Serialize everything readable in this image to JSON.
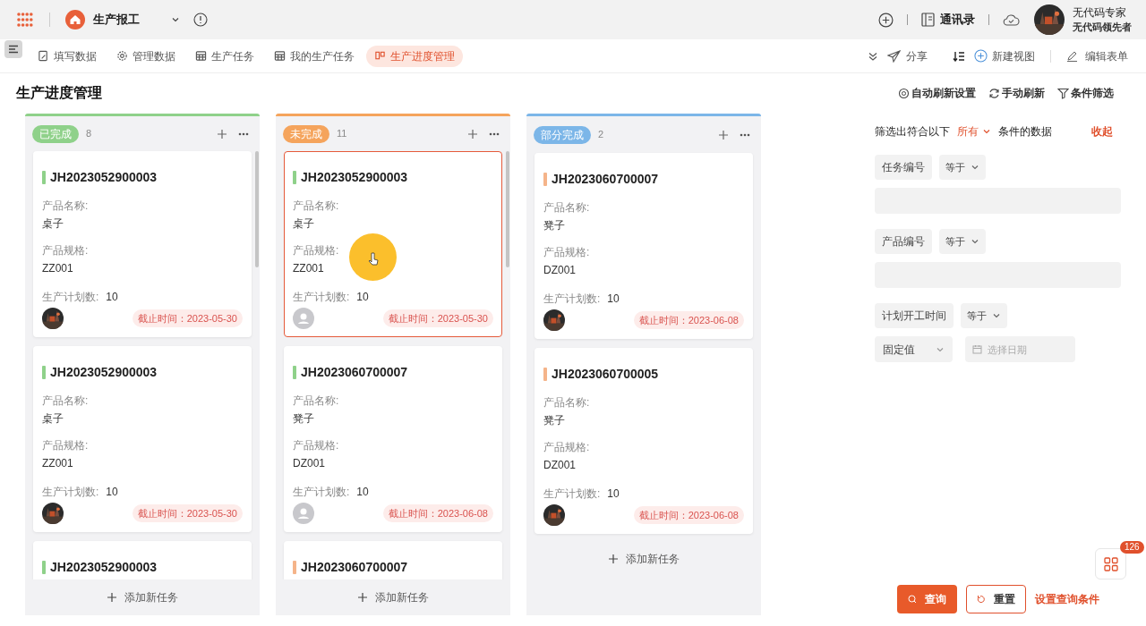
{
  "app": {
    "title": "生产报工"
  },
  "header": {
    "contacts": "通讯录",
    "user_name": "无代码专家",
    "user_role": "无代码领先者"
  },
  "tabs": [
    {
      "label": "填写数据",
      "selected": false
    },
    {
      "label": "管理数据",
      "selected": false
    },
    {
      "label": "生产任务",
      "selected": false
    },
    {
      "label": "我的生产任务",
      "selected": false
    },
    {
      "label": "生产进度管理",
      "selected": true
    }
  ],
  "toolbar": {
    "share": "分享",
    "new_view": "新建视图",
    "edit_form": "编辑表单"
  },
  "page_title": "生产进度管理",
  "page_actions": [
    "自动刷新设置",
    "手动刷新",
    "条件筛选"
  ],
  "columns": [
    {
      "label": "已完成",
      "count": "8",
      "color": "#8fd18a",
      "add_label": "添加新任务",
      "cards": [
        {
          "id": "JH2023052900003",
          "color": "#8fd18a",
          "selected": false,
          "name_label": "产品名称:",
          "name": "桌子",
          "spec_label": "产品规格:",
          "spec": "ZZ001",
          "qty_label": "生产计划数:",
          "qty": "10",
          "deadline": "截止时间：2023-05-30"
        },
        {
          "id": "JH2023052900003",
          "color": "#8fd18a",
          "selected": false,
          "name_label": "产品名称:",
          "name": "桌子",
          "spec_label": "产品规格:",
          "spec": "ZZ001",
          "qty_label": "生产计划数:",
          "qty": "10",
          "deadline": "截止时间：2023-05-30"
        },
        {
          "id": "JH2023052900003",
          "color": "#8fd18a",
          "selected": false
        }
      ]
    },
    {
      "label": "未完成",
      "count": "11",
      "color": "#f5a45c",
      "add_label": "添加新任务",
      "cards": [
        {
          "id": "JH2023052900003",
          "color": "#8fd18a",
          "selected": true,
          "name_label": "产品名称:",
          "name": "桌子",
          "spec_label": "产品规格:",
          "spec": "ZZ001",
          "qty_label": "生产计划数:",
          "qty": "10",
          "avatar": {
            "kind": "placeholder"
          },
          "deadline": "截止时间：2023-05-30"
        },
        {
          "id": "JH2023060700007",
          "color": "#8fd18a",
          "selected": false,
          "name_label": "产品名称:",
          "name": "凳子",
          "spec_label": "产品规格:",
          "spec": "DZ001",
          "qty_label": "生产计划数:",
          "qty": "10",
          "avatar": {
            "kind": "placeholder"
          },
          "deadline": "截止时间：2023-06-08"
        },
        {
          "id": "JH2023060700007",
          "color": "#f5b48a",
          "selected": false
        }
      ]
    },
    {
      "label": "部分完成",
      "count": "2",
      "color": "#7cb6e8",
      "add_label": "添加新任务",
      "cards": [
        {
          "id": "JH2023060700007",
          "color": "#f5b48a",
          "selected": false,
          "name_label": "产品名称:",
          "name": "凳子",
          "spec_label": "产品规格:",
          "spec": "DZ001",
          "qty_label": "生产计划数:",
          "qty": "10",
          "deadline": "截止时间：2023-06-08"
        },
        {
          "id": "JH2023060700005",
          "color": "#f5b48a",
          "selected": false,
          "name_label": "产品名称:",
          "name": "凳子",
          "spec_label": "产品规格:",
          "spec": "DZ001",
          "qty_label": "生产计划数:",
          "qty": "10",
          "deadline": "截止时间：2023-06-08"
        }
      ]
    }
  ],
  "filter": {
    "prefix": "筛选出符合以下",
    "match": "所有",
    "suffix": "条件的数据",
    "collapse": "收起",
    "conditions": [
      {
        "kind": "text",
        "field": "任务编号",
        "operator": "等于"
      },
      {
        "kind": "text",
        "field": "产品编号",
        "operator": "等于"
      },
      {
        "kind": "date",
        "field": "计划开工时间",
        "operator": "等于",
        "mode": "固定值",
        "placeholder": "选择日期"
      }
    ],
    "query": "查询",
    "reset": "重置",
    "settings": "设置查询条件"
  },
  "float_badge": "126"
}
